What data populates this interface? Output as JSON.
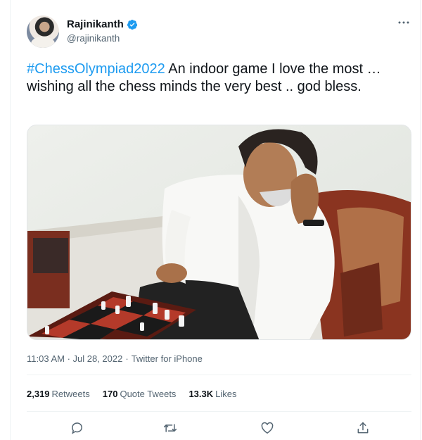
{
  "tweet": {
    "author": {
      "display_name": "Rajinikanth",
      "handle": "@rajinikanth",
      "verified": true
    },
    "text": {
      "hashtag": "#ChessOlympiad2022",
      "body": " An indoor game I love the most … wishing all the chess minds the very best .. god bless."
    },
    "media": {
      "description_icon": "photo"
    },
    "timestamp": "11:03 AM · Jul 28, 2022",
    "separator": "·",
    "source": "Twitter for iPhone",
    "stats": {
      "retweets_count": "2,319",
      "retweets_label": "Retweets",
      "quotes_count": "170",
      "quotes_label": "Quote Tweets",
      "likes_count": "13.3K",
      "likes_label": "Likes"
    },
    "actions": [
      "reply-icon",
      "retweet-icon",
      "like-icon",
      "share-icon"
    ]
  },
  "colors": {
    "accent": "#1d9bf0",
    "text": "#0f1419",
    "secondary": "#536471",
    "border": "#eff3f4"
  }
}
